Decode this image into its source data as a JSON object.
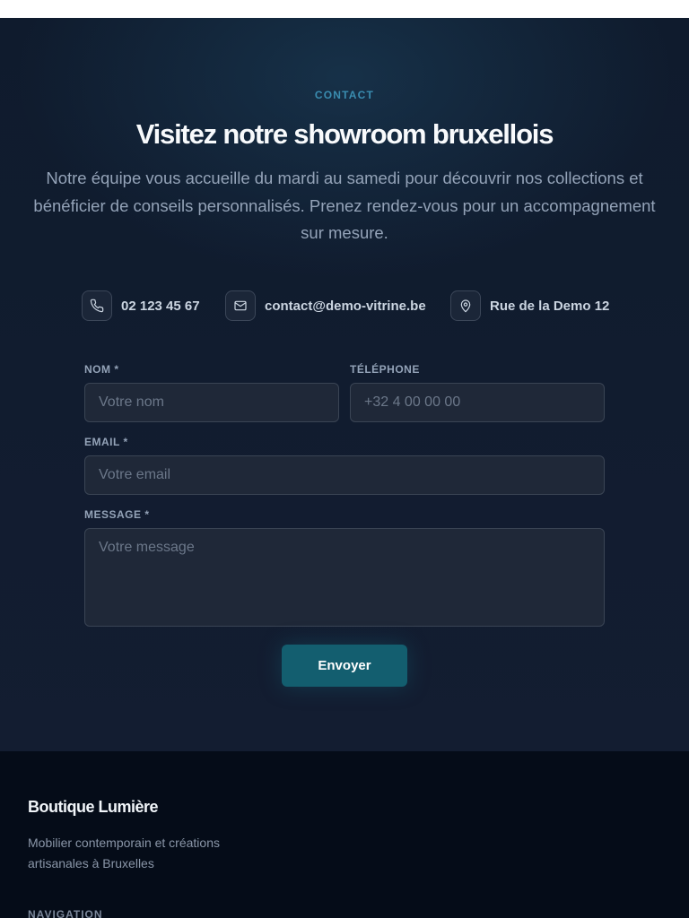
{
  "contact": {
    "eyebrow": "CONTACT",
    "title": "Visitez notre showroom bruxellois",
    "lead": "Notre équipe vous accueille du mardi au samedi pour découvrir nos collections et bénéficier de conseils personnalisés. Prenez rendez-vous pour un accompagnement sur mesure.",
    "info": {
      "phone": "02 123 45 67",
      "email": "contact@demo-vitrine.be",
      "address": "Rue de la Demo 12"
    }
  },
  "form": {
    "name_label": "NOM *",
    "name_placeholder": "Votre nom",
    "phone_label": "TÉLÉPHONE",
    "phone_placeholder": "+32 4 00 00 00",
    "email_label": "EMAIL *",
    "email_placeholder": "Votre email",
    "message_label": "MESSAGE *",
    "message_placeholder": "Votre message",
    "submit_label": "Envoyer"
  },
  "footer": {
    "brand": "Boutique Lumière",
    "tagline": "Mobilier contemporain et créations artisanales à Bruxelles",
    "nav_heading": "NAVIGATION"
  },
  "icons": {
    "phone": "phone-icon",
    "email": "mail-icon",
    "address": "map-pin-icon"
  }
}
